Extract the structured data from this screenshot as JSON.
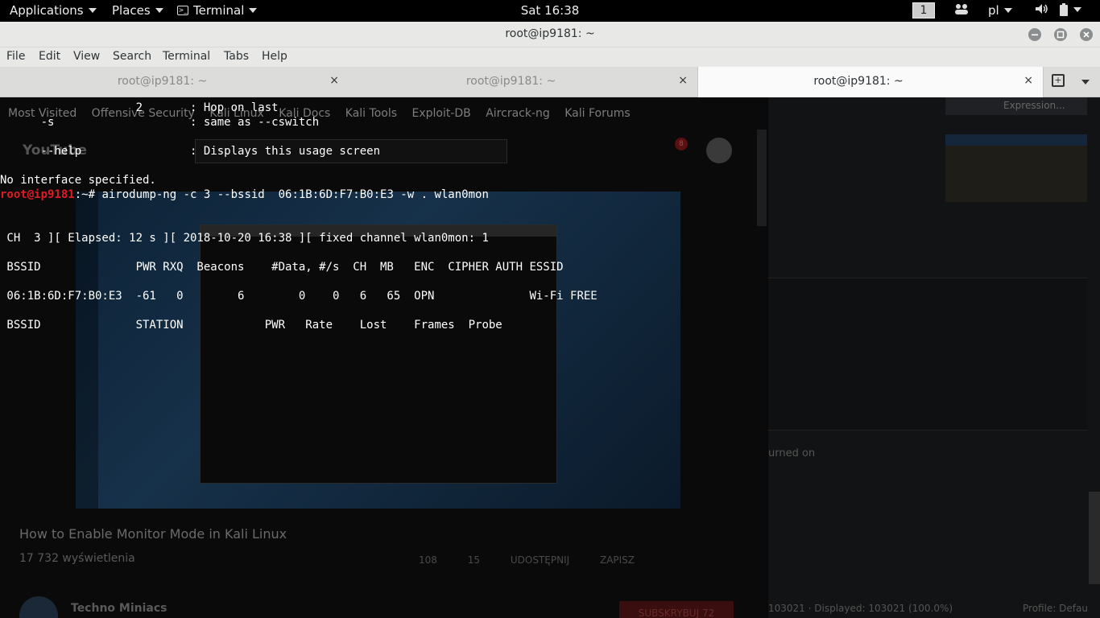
{
  "top_panel": {
    "applications": "Applications",
    "places": "Places",
    "terminal": "Terminal",
    "clock": "Sat 16:38",
    "workspace": "1",
    "keyboard_layout": "pl"
  },
  "window": {
    "title": "root@ip9181: ~",
    "menu": [
      "File",
      "Edit",
      "View",
      "Search",
      "Terminal",
      "Tabs",
      "Help"
    ],
    "tabs": [
      {
        "label": "root@ip9181: ~",
        "close": "×"
      },
      {
        "label": "root@ip9181: ~",
        "close": "×"
      },
      {
        "label": "root@ip9181: ~",
        "close": "×"
      }
    ]
  },
  "terminal": {
    "help_lines": [
      "                    2       : Hop on last",
      "      -s                    : same as --cswitch",
      "",
      "      --help                : Displays this usage screen"
    ],
    "error": "No interface specified.",
    "prompt_user": "root@ip9181",
    "prompt_rest": ":~# ",
    "command": "airodump-ng -c 3 --bssid  06:1B:6D:F7:B0:E3 -w . wlan0mon",
    "status_line": " CH  3 ][ Elapsed: 12 s ][ 2018-10-20 16:38 ][ fixed channel wlan0mon: 1",
    "ap_header": " BSSID              PWR RXQ  Beacons    #Data, #/s  CH  MB   ENC  CIPHER AUTH ESSID",
    "ap_row": " 06:1B:6D:F7:B0:E3  -61   0        6        0    0   6   65  OPN              Wi-Fi FREE",
    "station_header": " BSSID              STATION            PWR   Rate    Lost    Frames  Probe"
  },
  "background": {
    "bookmarks": [
      "Most Visited",
      "Offensive Security",
      "Kali Linux",
      "Kali Docs",
      "Kali Tools",
      "Exploit-DB",
      "Aircrack-ng",
      "Kali Forums"
    ],
    "youtube_logo": "YouTube",
    "video_title": "How to Enable Monitor Mode in Kali Linux",
    "views": "17 732 wyświetlenia",
    "likes": "108",
    "dislikes": "15",
    "share": "UDOSTĘPNIJ",
    "save": "ZAPISZ",
    "channel": "Techno Miniacs",
    "subscribe": "SUBSKRYBUJ 72",
    "notifications": "8",
    "right_expression": "Expression...",
    "right_turned": "urned on",
    "right_status_left": "103021 · Displayed: 103021 (100.0%)",
    "right_status_right": "Profile: Defau"
  }
}
